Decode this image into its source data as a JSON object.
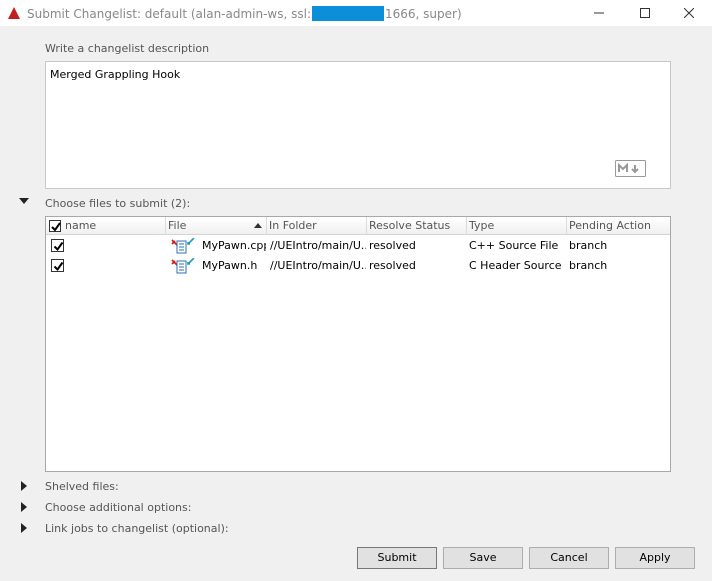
{
  "window": {
    "title_prefix": "Submit Changelist: default (alan-admin-ws,  ssl:",
    "title_suffix": "1666,  super)",
    "icons": {
      "app": "red-triangle-icon",
      "minimize": "minimize-icon",
      "maximize": "maximize-icon",
      "close": "close-icon"
    }
  },
  "description": {
    "label": "Write a changelist description",
    "text": "Merged Grappling Hook",
    "badge_icon": "markdown-icon"
  },
  "files_section": {
    "label": "Choose files to submit (2):",
    "columns": [
      "name",
      "File",
      "In Folder",
      "Resolve Status",
      "Type",
      "Pending Action"
    ],
    "rows": [
      {
        "checked": true,
        "file": "MyPawn.cpp",
        "folder": "//UEIntro/main/U...",
        "resolve": "resolved",
        "type": "C++ Source File",
        "action": "branch",
        "icon": "branch-file-icon"
      },
      {
        "checked": true,
        "file": "MyPawn.h",
        "folder": "//UEIntro/main/U...",
        "resolve": "resolved",
        "type": "C Header Source ...",
        "action": "branch",
        "icon": "branch-file-icon"
      }
    ]
  },
  "collapsed_sections": [
    {
      "label": "Shelved files:"
    },
    {
      "label": "Choose additional options:"
    },
    {
      "label": "Link jobs to changelist (optional):"
    }
  ],
  "buttons": {
    "submit": "Submit",
    "save": "Save",
    "cancel": "Cancel",
    "apply": "Apply"
  }
}
